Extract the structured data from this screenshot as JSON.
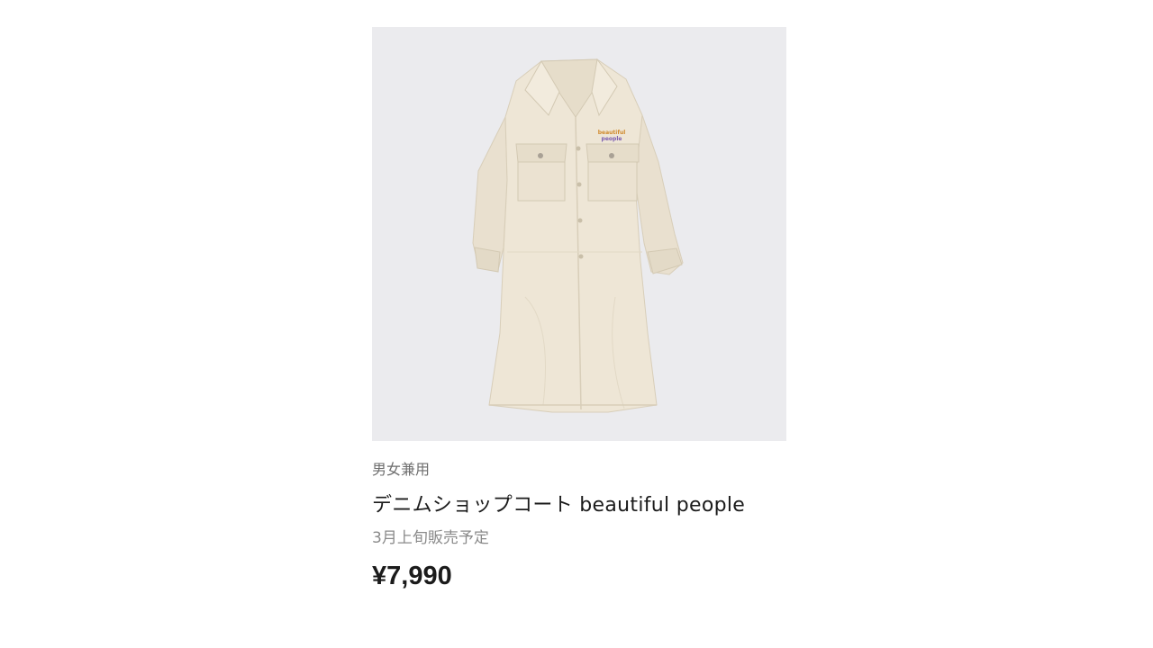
{
  "product": {
    "image_alt": "coat-product-image",
    "gender": "男女兼用",
    "name": "デニムショップコート beautiful people",
    "availability": "3月上旬販売予定",
    "price": "¥7,990",
    "embroidery_text_line1": "beautiful",
    "embroidery_text_line2": "people"
  },
  "colors": {
    "image_background": "#ebebee",
    "coat": "#eee6d6",
    "coat_shadow": "#ddd3bf",
    "price_text": "#1b1b1b"
  }
}
